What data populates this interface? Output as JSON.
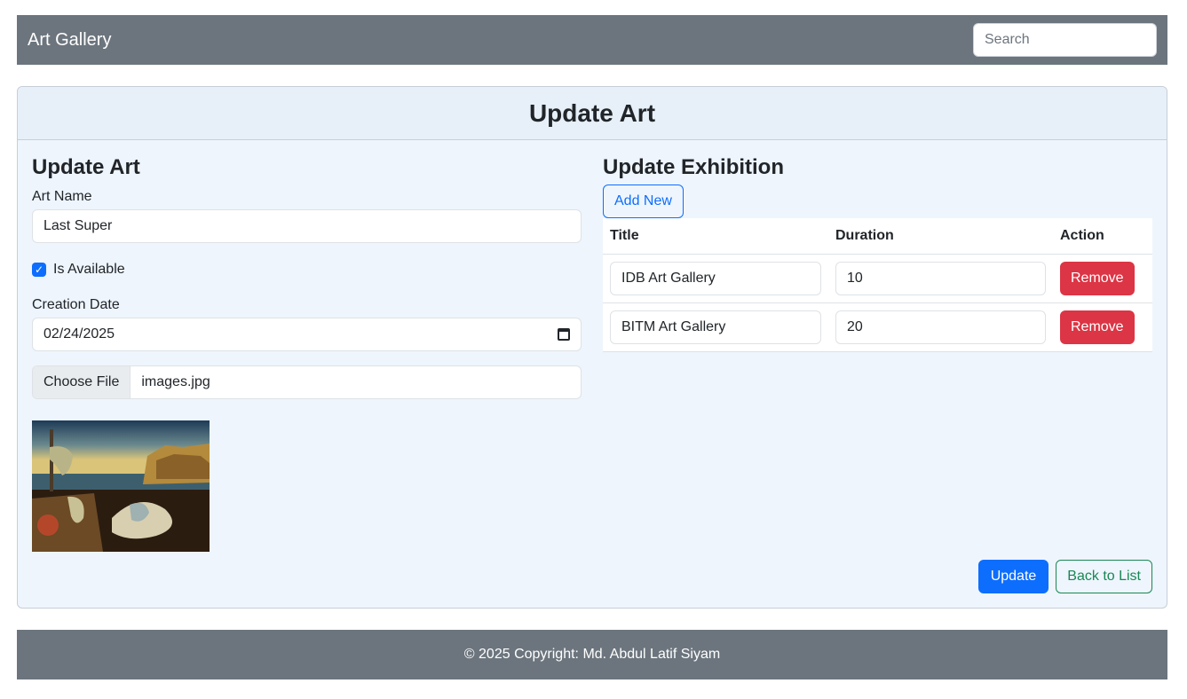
{
  "navbar": {
    "brand": "Art Gallery",
    "search_placeholder": "Search"
  },
  "card": {
    "header_title": "Update Art"
  },
  "art_form": {
    "section_title": "Update Art",
    "name_label": "Art Name",
    "name_value": "Last Super",
    "available_label": "Is Available",
    "available_checked": true,
    "date_label": "Creation Date",
    "date_value": "02/24/2025",
    "file_button": "Choose File",
    "file_name": "images.jpg",
    "image_subject": "melting clocks painting"
  },
  "exhibition": {
    "section_title": "Update Exhibition",
    "add_button": "Add New",
    "headers": [
      "Title",
      "Duration",
      "Action"
    ],
    "rows": [
      {
        "title": "IDB Art Gallery",
        "duration": "10",
        "action": "Remove"
      },
      {
        "title": "BITM Art Gallery",
        "duration": "20",
        "action": "Remove"
      }
    ]
  },
  "actions": {
    "update": "Update",
    "back": "Back to List"
  },
  "footer": {
    "text": "© 2025 Copyright: Md. Abdul Latif Siyam"
  },
  "colors": {
    "navbar": "#6c757d",
    "primary": "#0d6efd",
    "danger": "#dc3545",
    "success": "#198754",
    "card_bg": "#eef5fd"
  }
}
